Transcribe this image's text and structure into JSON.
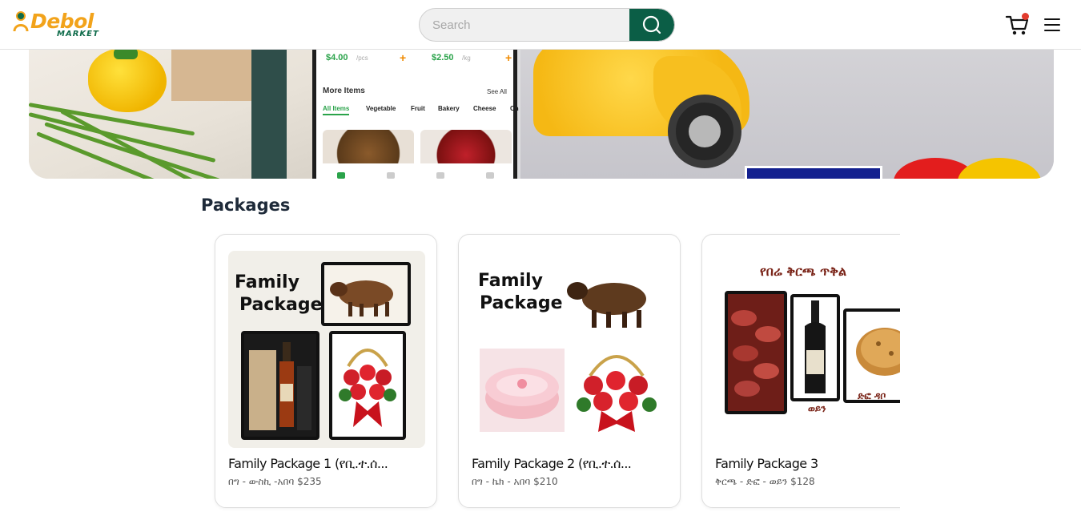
{
  "header": {
    "logo": {
      "word": "Debol",
      "sub": "MARKET"
    },
    "search": {
      "placeholder": "Search"
    },
    "cart": {
      "has_notification": true
    },
    "colors": {
      "brand_green": "#0b5e46",
      "brand_orange": "#f2a31b",
      "notification": "#e23b2e"
    }
  },
  "banner": {
    "phone": {
      "prices": [
        {
          "price": "$4.00",
          "unit": "/pcs"
        },
        {
          "price": "$2.50",
          "unit": "/kg"
        }
      ],
      "more_items": "More Items",
      "see_all": "See All",
      "categories": [
        "All Items",
        "Vegetable",
        "Fruit",
        "Bakery",
        "Cheese",
        "Ch"
      ]
    }
  },
  "packages": {
    "title": "Packages",
    "items": [
      {
        "title": "Family Package 1 (የቢ.ተ.ሰ...",
        "desc": "በግ - ውስኪ -አበባ $235",
        "image": {
          "line1": "Family",
          "line2": "Package"
        }
      },
      {
        "title": "Family Package 2 (የቢ.ተ.ሰ...",
        "desc": "በግ - ኬክ - አበባ $210",
        "image": {
          "line1": "Family",
          "line2": "Package"
        }
      },
      {
        "title": "Family Package 3",
        "desc": "ቅርጫ - ድፎ - ወይን $128",
        "image": {
          "heading": "የበሬ ቅርጫ ጥቅል",
          "label_wine": "ወይን",
          "label_bread": "ድፎ ዳቦ"
        }
      }
    ]
  }
}
